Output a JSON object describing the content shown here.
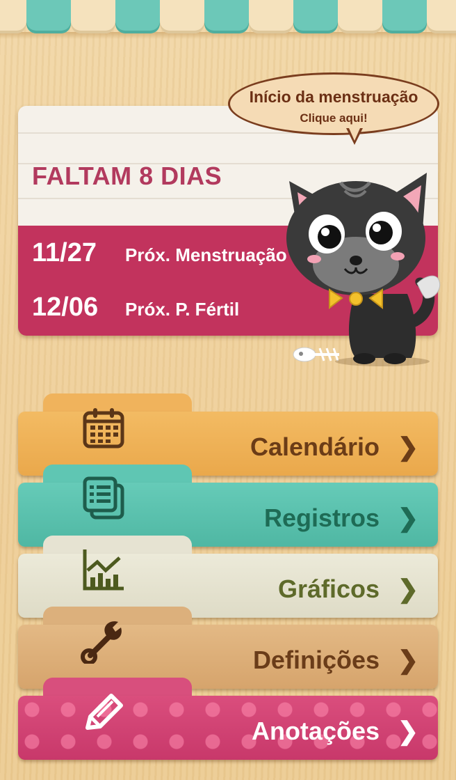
{
  "colors": {
    "accent_pink": "#c2335d",
    "countdown_text": "#b23a5e",
    "tab_calendar": "#f0b35c",
    "tab_records": "#5fc6b3",
    "tab_graphs": "#e6e3d2",
    "tab_settings": "#dcb07c",
    "tab_notes": "#d84f7d"
  },
  "bubble": {
    "title": "Início da menstruação",
    "subtitle": "Clique aqui!"
  },
  "summary": {
    "countdown": "FALTAM 8 DIAS",
    "next_period": {
      "date": "11/27",
      "label": "Próx. Menstruação"
    },
    "next_fertile": {
      "date": "12/06",
      "label": "Próx. P. Fértil"
    }
  },
  "menu": [
    {
      "label": "Calendário",
      "icon": "calendar-icon"
    },
    {
      "label": "Registros",
      "icon": "records-icon"
    },
    {
      "label": "Gráficos",
      "icon": "chart-icon"
    },
    {
      "label": "Definições",
      "icon": "wrench-icon"
    },
    {
      "label": "Anotações",
      "icon": "pencil-icon"
    }
  ],
  "chevron": "❯"
}
